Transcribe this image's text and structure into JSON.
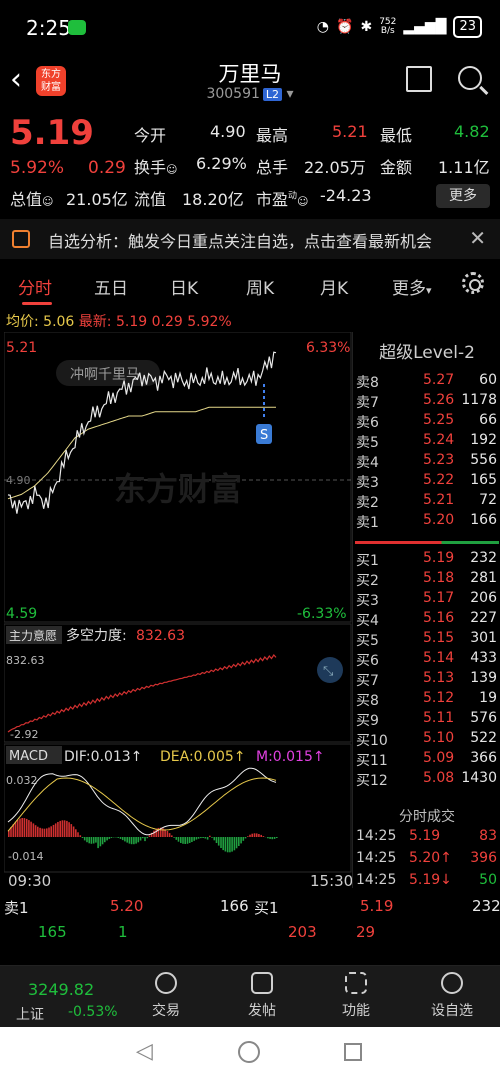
{
  "status": {
    "time": "2:25",
    "net_speed": "752",
    "net_unit": "B/s",
    "battery": "23"
  },
  "header": {
    "title": "万里马",
    "code": "300591",
    "level": "L2",
    "logo_text": "东方财富"
  },
  "quote": {
    "price": "5.19",
    "pct": "5.92%",
    "change": "0.29",
    "open_label": "今开",
    "open": "4.90",
    "high_label": "最高",
    "high": "5.21",
    "low_label": "最低",
    "low": "4.82",
    "turnover_label": "换手",
    "turnover": "6.29%",
    "volume_label": "总手",
    "volume": "22.05万",
    "amount_label": "金额",
    "amount": "1.11亿",
    "mcap_label": "总值",
    "mcap": "21.05亿",
    "float_label": "流值",
    "float": "18.20亿",
    "pe_label": "市盈",
    "pe_sup": "动",
    "pe": "-24.23",
    "more": "更多"
  },
  "notice": {
    "text": "自选分析：触发今日重点关注自选，点击查看最新机会"
  },
  "tabs": [
    "分时",
    "五日",
    "日K",
    "周K",
    "月K",
    "更多"
  ],
  "infoline": {
    "avg_label": "均价:",
    "avg": "5.06",
    "last_label": "最新:",
    "last": "5.19",
    "chg": "0.29",
    "pct": "5.92%"
  },
  "chart": {
    "top_price": "5.21",
    "top_pct": "6.33%",
    "bottom_price": "4.59",
    "bottom_pct": "-6.33%",
    "watermark": "东方财富",
    "annotation": "冲啊千里马",
    "time_start": "09:30",
    "time_end": "15:30",
    "badge": "S",
    "mid_label": "4.90",
    "force_label": "主力意愿",
    "force_name": "多空力度:",
    "force_value": "832.63",
    "force_max": "832.63",
    "force_min": "-2.92",
    "macd_label": "MACD",
    "dif": "DIF:0.013↑",
    "dea": "DEA:0.005↑",
    "m": "M:0.015↑",
    "macd_max": "0.032",
    "macd_min": "-0.014"
  },
  "chart_data": {
    "type": "line",
    "series": [
      {
        "name": "最新",
        "values": [
          4.85,
          4.83,
          4.86,
          4.84,
          4.92,
          4.98,
          5.03,
          5.06,
          5.09,
          5.11,
          5.13,
          5.12,
          5.13,
          5.12,
          5.12,
          5.13,
          5.12,
          5.13,
          5.12,
          5.14,
          5.19
        ]
      },
      {
        "name": "均价",
        "values": [
          4.85,
          4.86,
          4.88,
          4.91,
          4.95,
          4.99,
          5.01,
          5.02,
          5.03,
          5.04,
          5.04,
          5.05,
          5.05,
          5.05,
          5.05,
          5.06,
          5.06,
          5.06,
          5.06,
          5.06,
          5.06
        ]
      }
    ],
    "ylim": [
      4.59,
      5.21
    ]
  },
  "level2": {
    "title": "超级Level-2",
    "asks": [
      {
        "label": "卖8",
        "price": "5.27",
        "vol": "60"
      },
      {
        "label": "卖7",
        "price": "5.26",
        "vol": "1178"
      },
      {
        "label": "卖6",
        "price": "5.25",
        "vol": "66"
      },
      {
        "label": "卖5",
        "price": "5.24",
        "vol": "192"
      },
      {
        "label": "卖4",
        "price": "5.23",
        "vol": "556"
      },
      {
        "label": "卖3",
        "price": "5.22",
        "vol": "165"
      },
      {
        "label": "卖2",
        "price": "5.21",
        "vol": "72"
      },
      {
        "label": "卖1",
        "price": "5.20",
        "vol": "166"
      }
    ],
    "bids": [
      {
        "label": "买1",
        "price": "5.19",
        "vol": "232"
      },
      {
        "label": "买2",
        "price": "5.18",
        "vol": "281"
      },
      {
        "label": "买3",
        "price": "5.17",
        "vol": "206"
      },
      {
        "label": "买4",
        "price": "5.16",
        "vol": "227"
      },
      {
        "label": "买5",
        "price": "5.15",
        "vol": "301"
      },
      {
        "label": "买6",
        "price": "5.14",
        "vol": "433"
      },
      {
        "label": "买7",
        "price": "5.13",
        "vol": "139"
      },
      {
        "label": "买8",
        "price": "5.12",
        "vol": "19"
      },
      {
        "label": "买9",
        "price": "5.11",
        "vol": "576"
      },
      {
        "label": "买10",
        "price": "5.10",
        "vol": "522"
      },
      {
        "label": "买11",
        "price": "5.09",
        "vol": "366"
      },
      {
        "label": "买12",
        "price": "5.08",
        "vol": "1430"
      }
    ],
    "trades_title": "分时成交",
    "trades": [
      {
        "time": "14:25",
        "price": "5.19",
        "vol": "83"
      },
      {
        "time": "14:25",
        "price": "5.20↑",
        "vol": "396"
      },
      {
        "time": "14:25",
        "price": "5.19↓",
        "vol": "50"
      }
    ]
  },
  "bottom_quote": {
    "sell_label": "卖1",
    "sell_price": "5.20",
    "sell_vol": "166",
    "buy_label": "买1",
    "buy_price": "5.19",
    "buy_vol": "232",
    "n1": "165",
    "n2": "1",
    "n3": "203",
    "n4": "29"
  },
  "nav": {
    "index_value": "3249.82",
    "index_name": "上证",
    "index_pct": "-0.53%",
    "items": [
      "交易",
      "发帖",
      "功能",
      "设自选"
    ]
  }
}
